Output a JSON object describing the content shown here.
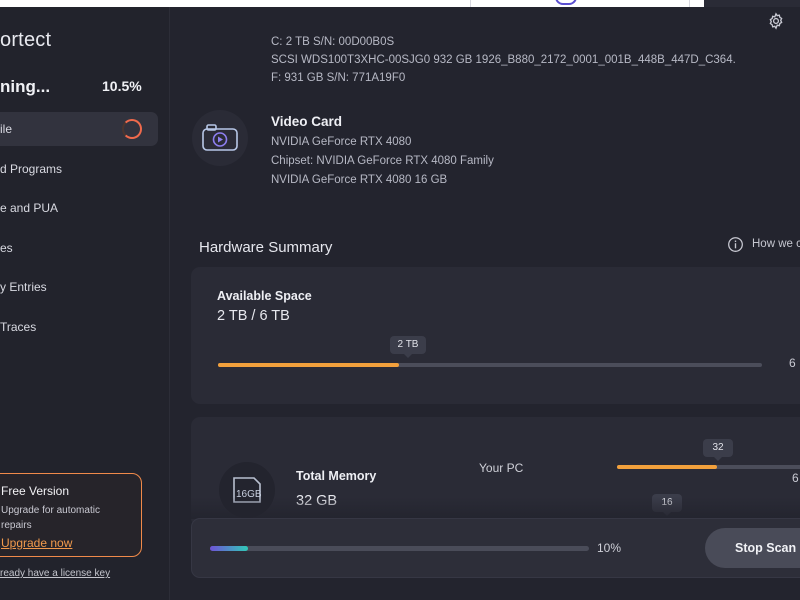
{
  "app": {
    "logo_text": "ortect"
  },
  "sidebar": {
    "scan_status": "ning...",
    "scan_percent": "10.5%",
    "nav": [
      {
        "label": "ile",
        "active": true
      },
      {
        "label": "d Programs"
      },
      {
        "label": "e and PUA"
      },
      {
        "label": "es"
      },
      {
        "label": "y Entries"
      },
      {
        "label": "Traces"
      }
    ],
    "promo": {
      "title": "Free Version",
      "text": "Upgrade for automatic repairs",
      "link": "Upgrade now"
    },
    "license_link": "ready have a license key"
  },
  "main": {
    "drives": [
      "C: 2 TB S/N: 00D00B0S",
      "SCSI WDS100T3XHC-00SJG0 932 GB 1926_B880_2172_0001_001B_448B_447D_C364.",
      "F: 931 GB S/N: 771A19F0"
    ],
    "video_card": {
      "title": "Video Card",
      "lines": [
        "NVIDIA GeForce RTX 4080",
        "Chipset: NVIDIA GeForce RTX 4080 Family",
        "NVIDIA GeForce RTX 4080 16 GB"
      ]
    },
    "hardware_summary": {
      "title": "Hardware Summary",
      "help": "How we c",
      "available_space": {
        "label": "Available Space",
        "value": "2 TB / 6 TB",
        "tooltip": "2 TB",
        "edge": "6",
        "fraction": 0.3333
      },
      "memory": {
        "label": "Total Memory",
        "value": "32 GB",
        "icon_text": "16GB",
        "your_pc": "Your PC",
        "pc_tooltip": "32",
        "pc_fraction": 0.5,
        "pc_edge": "6",
        "second_tooltip": "16"
      }
    },
    "scan": {
      "percent": "10%",
      "fraction": 0.1,
      "stop_label": "Stop Scan"
    }
  },
  "colors": {
    "accent_orange": "#f2a03c",
    "spinner": "#f06a4c",
    "promo_border": "#f08a4a",
    "background": "#23242e"
  }
}
